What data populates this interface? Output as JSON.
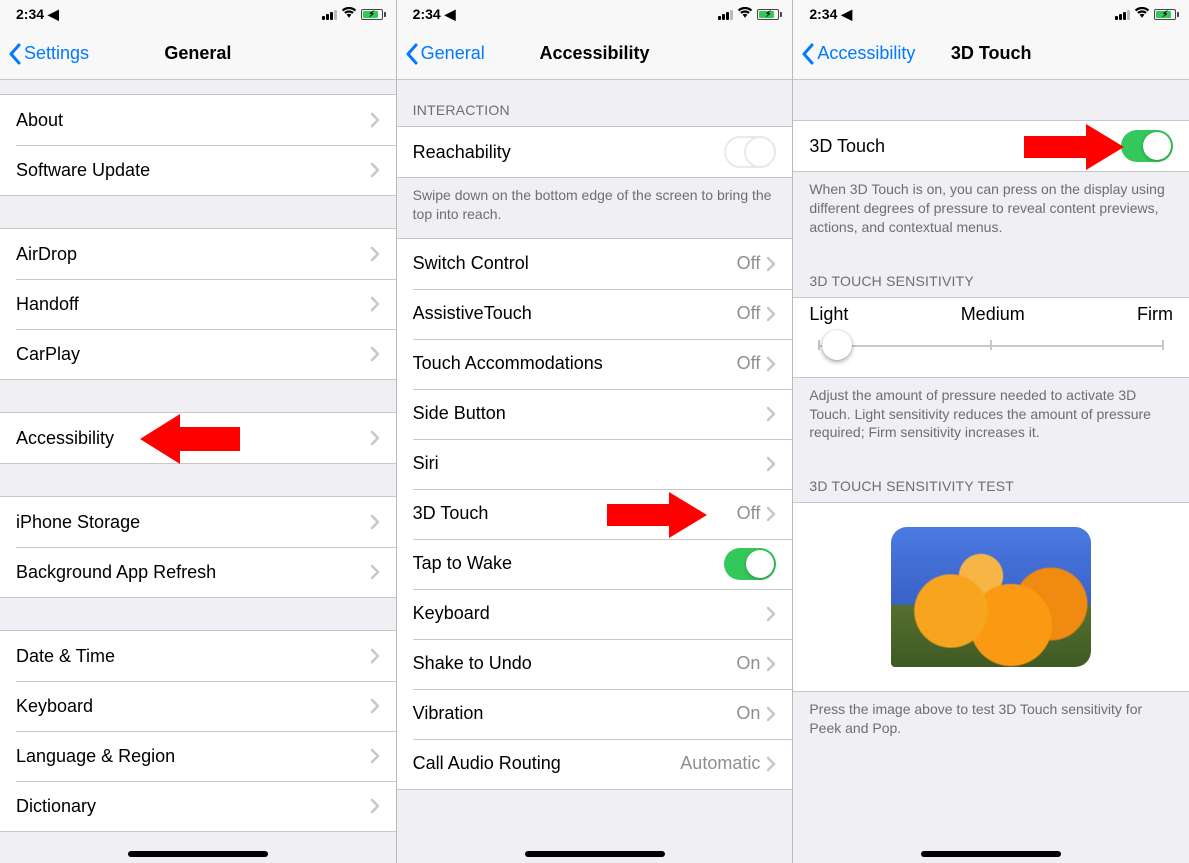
{
  "status": {
    "time": "2:34"
  },
  "pane1": {
    "back": "Settings",
    "title": "General",
    "g1": [
      {
        "label": "About"
      },
      {
        "label": "Software Update"
      }
    ],
    "g2": [
      {
        "label": "AirDrop"
      },
      {
        "label": "Handoff"
      },
      {
        "label": "CarPlay"
      }
    ],
    "g3": [
      {
        "label": "Accessibility"
      }
    ],
    "g4": [
      {
        "label": "iPhone Storage"
      },
      {
        "label": "Background App Refresh"
      }
    ],
    "g5": [
      {
        "label": "Date & Time"
      },
      {
        "label": "Keyboard"
      },
      {
        "label": "Language & Region"
      },
      {
        "label": "Dictionary"
      }
    ]
  },
  "pane2": {
    "back": "General",
    "title": "Accessibility",
    "interaction_header": "INTERACTION",
    "reachability": {
      "label": "Reachability"
    },
    "reachability_footer": "Swipe down on the bottom edge of the screen to bring the top into reach.",
    "rows": [
      {
        "label": "Switch Control",
        "value": "Off"
      },
      {
        "label": "AssistiveTouch",
        "value": "Off"
      },
      {
        "label": "Touch Accommodations",
        "value": "Off"
      },
      {
        "label": "Side Button",
        "value": ""
      },
      {
        "label": "Siri",
        "value": ""
      },
      {
        "label": "3D Touch",
        "value": "Off"
      },
      {
        "label": "Tap to Wake",
        "toggle": true
      },
      {
        "label": "Keyboard",
        "value": ""
      },
      {
        "label": "Shake to Undo",
        "value": "On"
      },
      {
        "label": "Vibration",
        "value": "On"
      },
      {
        "label": "Call Audio Routing",
        "value": "Automatic"
      }
    ]
  },
  "pane3": {
    "back": "Accessibility",
    "title": "3D Touch",
    "toggle": {
      "label": "3D Touch"
    },
    "toggle_footer": "When 3D Touch is on, you can press on the display using different degrees of pressure to reveal content previews, actions, and contextual menus.",
    "sensitivity_header": "3D TOUCH SENSITIVITY",
    "slider": {
      "light": "Light",
      "medium": "Medium",
      "firm": "Firm"
    },
    "sensitivity_footer": "Adjust the amount of pressure needed to activate 3D Touch. Light sensitivity reduces the amount of pressure required; Firm sensitivity increases it.",
    "test_header": "3D TOUCH SENSITIVITY TEST",
    "test_footer": "Press the image above to test 3D Touch sensitivity for Peek and Pop."
  }
}
